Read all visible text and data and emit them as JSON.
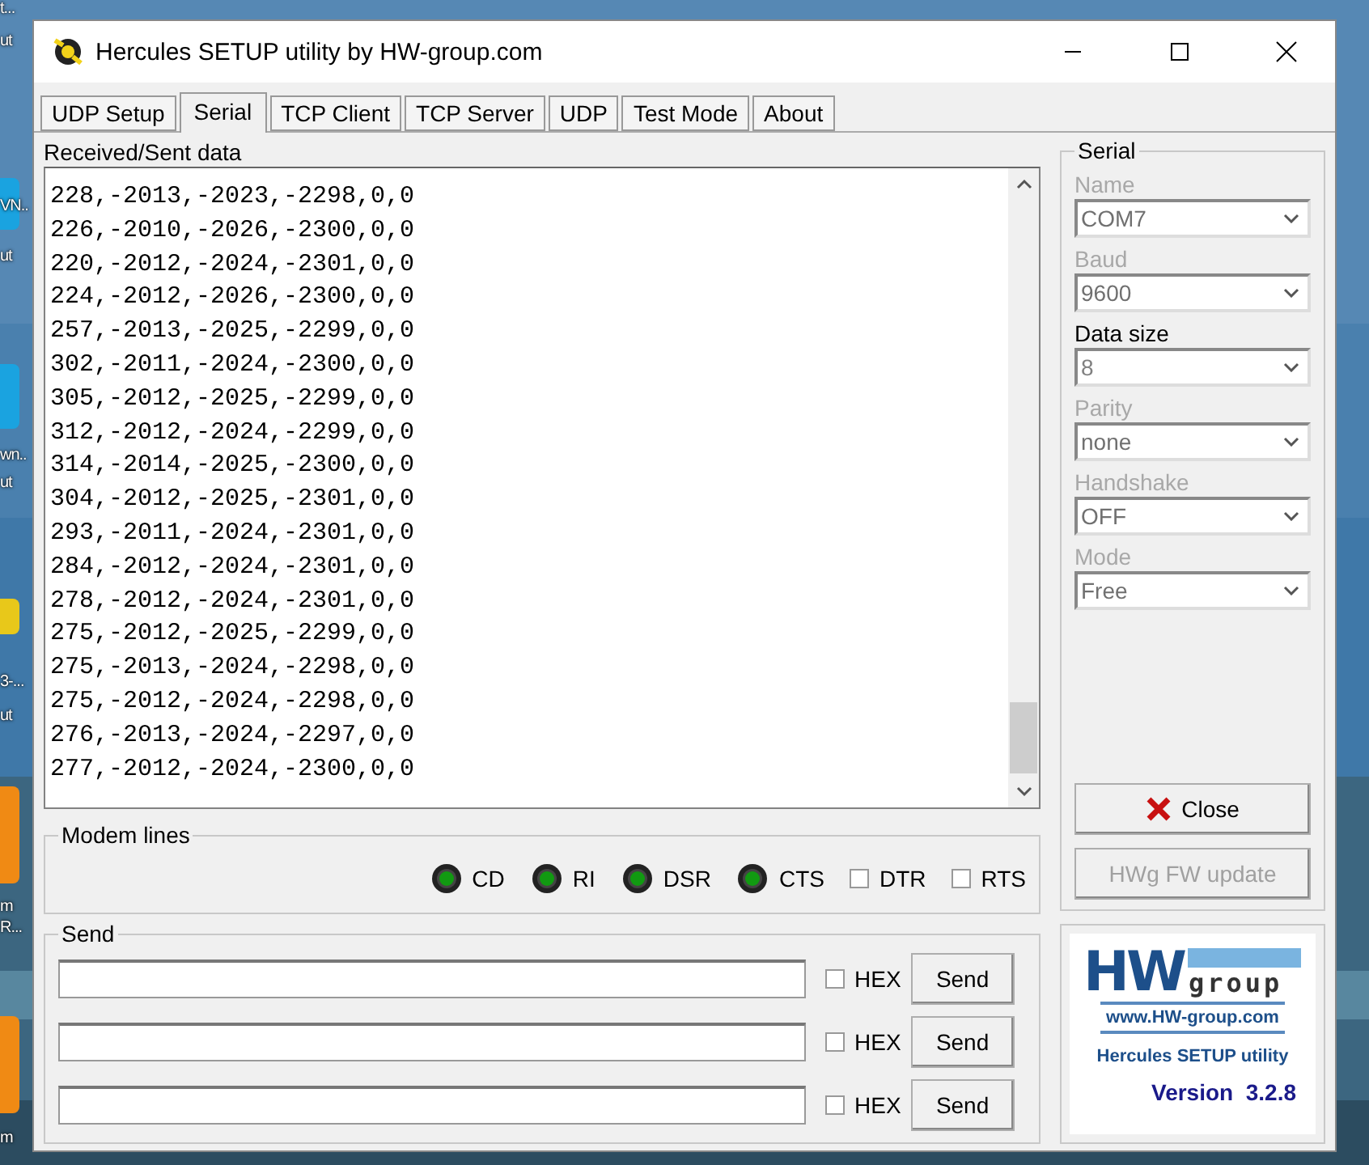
{
  "desktop": {
    "labels": [
      {
        "text": "t..."
      },
      {
        "text": "ut"
      },
      {
        "text": "VN.."
      },
      {
        "text": "ut"
      },
      {
        "text": "wn.."
      },
      {
        "text": "ut"
      },
      {
        "text": "3-..."
      },
      {
        "text": "ut"
      },
      {
        "text": "m"
      },
      {
        "text": "R..."
      },
      {
        "text": "m"
      }
    ]
  },
  "window": {
    "title": "Hercules SETUP utility by HW-group.com"
  },
  "tabs": [
    {
      "label": "UDP Setup",
      "selected": false
    },
    {
      "label": "Serial",
      "selected": true
    },
    {
      "label": "TCP Client",
      "selected": false
    },
    {
      "label": "TCP Server",
      "selected": false
    },
    {
      "label": "UDP",
      "selected": false
    },
    {
      "label": "Test Mode",
      "selected": false
    },
    {
      "label": "About",
      "selected": false
    }
  ],
  "received": {
    "label": "Received/Sent data",
    "lines": [
      "228,-2013,-2023,-2298,0,0",
      "226,-2010,-2026,-2300,0,0",
      "220,-2012,-2024,-2301,0,0",
      "224,-2012,-2026,-2300,0,0",
      "257,-2013,-2025,-2299,0,0",
      "302,-2011,-2024,-2300,0,0",
      "305,-2012,-2025,-2299,0,0",
      "312,-2012,-2024,-2299,0,0",
      "314,-2014,-2025,-2300,0,0",
      "304,-2012,-2025,-2301,0,0",
      "293,-2011,-2024,-2301,0,0",
      "284,-2012,-2024,-2301,0,0",
      "278,-2012,-2024,-2301,0,0",
      "275,-2012,-2025,-2299,0,0",
      "275,-2013,-2024,-2298,0,0",
      "275,-2012,-2024,-2298,0,0",
      "276,-2013,-2024,-2297,0,0",
      "277,-2012,-2024,-2300,0,0"
    ]
  },
  "modem_lines": {
    "label": "Modem lines",
    "items": [
      {
        "kind": "led",
        "label": "CD",
        "on": true
      },
      {
        "kind": "led",
        "label": "RI",
        "on": true
      },
      {
        "kind": "led",
        "label": "DSR",
        "on": true
      },
      {
        "kind": "led",
        "label": "CTS",
        "on": true
      },
      {
        "kind": "checkbox",
        "label": "DTR",
        "checked": false
      },
      {
        "kind": "checkbox",
        "label": "RTS",
        "checked": false
      }
    ]
  },
  "send": {
    "label": "Send",
    "rows": [
      {
        "hex_label": "HEX",
        "hex_checked": false,
        "button": "Send"
      },
      {
        "hex_label": "HEX",
        "hex_checked": false,
        "button": "Send"
      },
      {
        "hex_label": "HEX",
        "hex_checked": false,
        "button": "Send"
      }
    ]
  },
  "serial": {
    "label": "Serial",
    "fields": [
      {
        "label": "Name",
        "value": "COM7",
        "disabled": true
      },
      {
        "label": "Baud",
        "value": "9600",
        "disabled": true
      },
      {
        "label": "Data size",
        "value": "8",
        "disabled": false
      },
      {
        "label": "Parity",
        "value": "none",
        "disabled": true
      },
      {
        "label": "Handshake",
        "value": "OFF",
        "disabled": true
      },
      {
        "label": "Mode",
        "value": "Free",
        "disabled": true
      }
    ],
    "buttons": [
      {
        "label": "Close",
        "disabled": false
      },
      {
        "label": "HWg FW update",
        "disabled": true
      }
    ]
  },
  "logo": {
    "brand_big": "HW",
    "brand_small": "group",
    "url": "www.HW-group.com",
    "product": "Hercules SETUP utility",
    "version": "Version  3.2.8"
  }
}
